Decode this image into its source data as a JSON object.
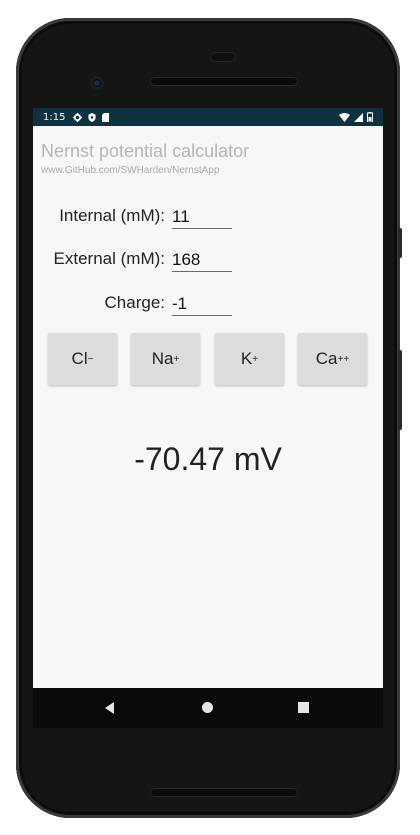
{
  "status_bar": {
    "time": "1:15",
    "left_icons": [
      "gear-icon",
      "shield-icon",
      "sd-card-icon"
    ],
    "right_icons": [
      "wifi-icon",
      "signal-icon",
      "battery-icon"
    ]
  },
  "app": {
    "title": "Nernst potential calculator",
    "subtitle": "www.GitHub.com/SWHarden/NernstApp"
  },
  "form": {
    "internal_label": "Internal (mM):",
    "internal_value": "11",
    "external_label": "External (mM):",
    "external_value": "168",
    "charge_label": "Charge:",
    "charge_value": "-1"
  },
  "ions": [
    {
      "base": "Cl",
      "charge": "−"
    },
    {
      "base": "Na",
      "charge": "+"
    },
    {
      "base": "K",
      "charge": "+"
    },
    {
      "base": "Ca",
      "charge": "++"
    }
  ],
  "result": "-70.47 mV",
  "nav": [
    "back-icon",
    "home-icon",
    "recents-icon"
  ],
  "colors": {
    "status_bar": "#0e3240",
    "screen_bg": "#f7f7f7",
    "button_bg": "#dcdcdc"
  }
}
